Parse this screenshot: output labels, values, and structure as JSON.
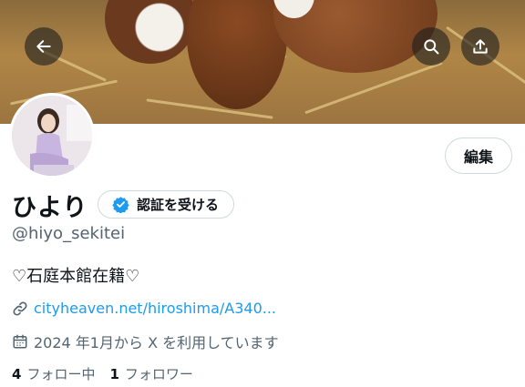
{
  "profile": {
    "name": "ひより",
    "verify_label": "認証を受ける",
    "handle": "@hiyo_sekitei",
    "bio": "♡石庭本館在籍♡",
    "link_text": "cityheaven.net/hiroshima/A340...",
    "joined": "2024 年1月から X を利用しています",
    "following_count": "4",
    "following_label": "フォロー中",
    "followers_count": "1",
    "followers_label": "フォロワー"
  },
  "actions": {
    "edit_label": "編集"
  },
  "icons": [
    "back-arrow-icon",
    "search-icon",
    "share-icon",
    "verified-badge-icon",
    "link-icon",
    "calendar-icon"
  ],
  "colors": {
    "accent": "#1d9bf0",
    "text": "#0f1419",
    "muted": "#536471",
    "border": "#cfd9de"
  }
}
